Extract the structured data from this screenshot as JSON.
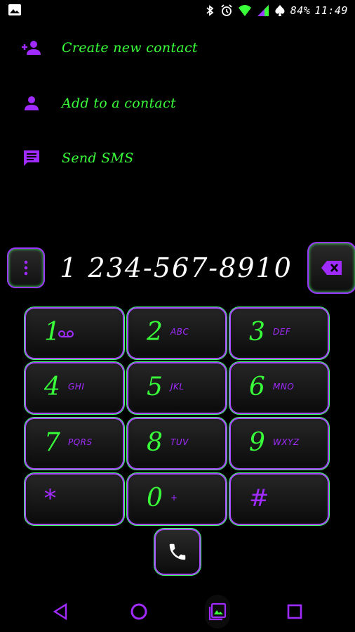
{
  "status_bar": {
    "battery_text": "84%",
    "time": "11:49",
    "icons": [
      "image-icon",
      "bluetooth-icon",
      "alarm-icon",
      "wifi-icon",
      "signal-icon",
      "spade-icon"
    ]
  },
  "actions": [
    {
      "label": "Create new contact",
      "icon": "add-person-icon"
    },
    {
      "label": "Add to a contact",
      "icon": "person-icon"
    },
    {
      "label": "Send SMS",
      "icon": "message-icon"
    }
  ],
  "dialer": {
    "number": "1 234-567-8910",
    "keys": [
      {
        "digit": "1",
        "letters": "",
        "voicemail": true
      },
      {
        "digit": "2",
        "letters": "ABC"
      },
      {
        "digit": "3",
        "letters": "DEF"
      },
      {
        "digit": "4",
        "letters": "GHI"
      },
      {
        "digit": "5",
        "letters": "JKL"
      },
      {
        "digit": "6",
        "letters": "MNO"
      },
      {
        "digit": "7",
        "letters": "PQRS"
      },
      {
        "digit": "8",
        "letters": "TUV"
      },
      {
        "digit": "9",
        "letters": "WXYZ"
      },
      {
        "digit": "*",
        "letters": ""
      },
      {
        "digit": "0",
        "letters": "+"
      },
      {
        "digit": "#",
        "letters": ""
      }
    ]
  },
  "nav": [
    "back-icon",
    "home-icon",
    "recents-gallery-icon",
    "overview-icon"
  ],
  "colors": {
    "green": "#39ff3a",
    "purple": "#a02bff",
    "background": "#000000"
  }
}
